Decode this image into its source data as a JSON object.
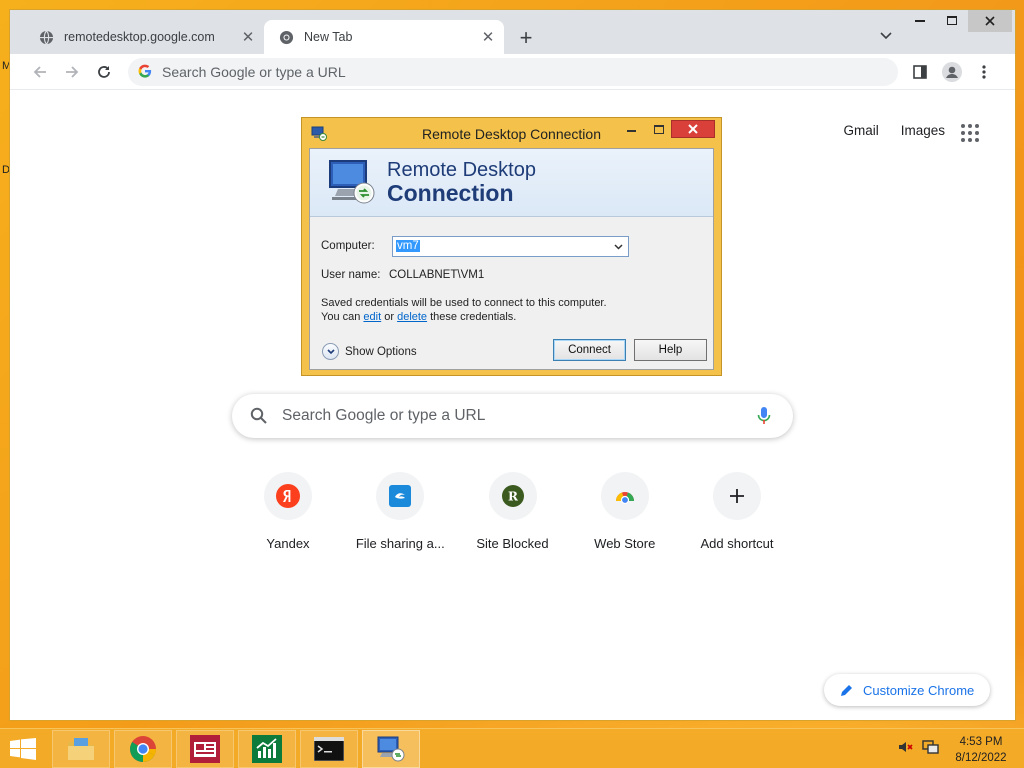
{
  "desktop": {
    "fragments": [
      "M",
      "D"
    ]
  },
  "browser": {
    "tabs": [
      {
        "title": "remotedesktop.google.com",
        "icon": "globe-icon",
        "active": false
      },
      {
        "title": "New Tab",
        "icon": "chrome-icon",
        "active": true
      }
    ],
    "omnibox_placeholder": "Search Google or type a URL",
    "top_links": {
      "gmail": "Gmail",
      "images": "Images"
    },
    "ntp_search_placeholder": "Search Google or type a URL",
    "shortcuts": [
      {
        "label": "Yandex",
        "icon": "yandex-icon",
        "color": "#fc3f1d"
      },
      {
        "label": "File sharing a...",
        "icon": "file-sharing-icon",
        "color": "#1c8adb"
      },
      {
        "label": "Site Blocked",
        "icon": "site-blocked-icon",
        "color": "#3b5a1f"
      },
      {
        "label": "Web Store",
        "icon": "web-store-icon",
        "color": "#ea4335"
      },
      {
        "label": "Add shortcut",
        "icon": "plus-icon",
        "color": "#202124"
      }
    ],
    "shortcut_letters": {
      "site_blocked": "R"
    },
    "customize_label": "Customize Chrome",
    "accent": "#1a73e8"
  },
  "rdc_dialog": {
    "title": "Remote Desktop Connection",
    "banner_line1": "Remote Desktop",
    "banner_line2": "Connection",
    "computer_label": "Computer:",
    "computer_value": "vm7",
    "username_label": "User name:",
    "username_value": "COLLABNET\\VM1",
    "info_line1": "Saved credentials will be used to connect to this computer.",
    "info_you_can": "You can",
    "info_edit": "edit",
    "info_or": "or",
    "info_delete": "delete",
    "info_tail": "these credentials.",
    "show_options": "Show Options",
    "connect": "Connect",
    "help": "Help"
  },
  "taskbar": {
    "apps": [
      "file-explorer-icon",
      "chrome-icon",
      "news-app-icon",
      "finance-app-icon",
      "command-prompt-icon",
      "remote-desktop-icon"
    ],
    "time": "4:53 PM",
    "date": "8/12/2022"
  }
}
